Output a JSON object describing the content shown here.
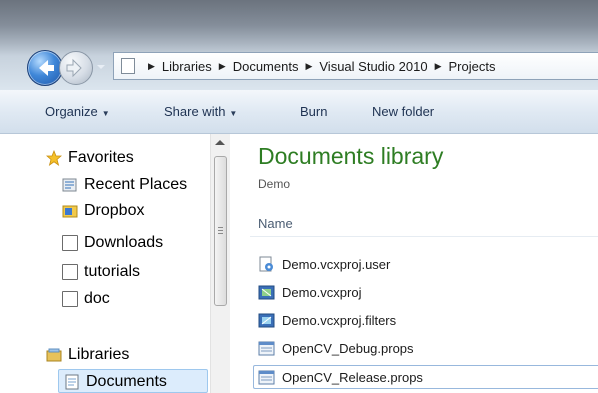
{
  "address": {
    "crumbs": [
      "Libraries",
      "Documents",
      "Visual Studio 2010",
      "Projects"
    ]
  },
  "toolbar": {
    "organize": "Organize",
    "share_with": "Share with",
    "burn": "Burn",
    "new_folder": "New folder"
  },
  "nav": {
    "favorites": "Favorites",
    "items": [
      "Recent Places",
      "Dropbox",
      "Downloads",
      "tutorials",
      "doc"
    ],
    "libraries": "Libraries",
    "documents": "Documents"
  },
  "content": {
    "title": "Documents library",
    "subtitle": "Demo",
    "column_name": "Name",
    "files": [
      "Demo.vcxproj.user",
      "Demo.vcxproj",
      "Demo.vcxproj.filters",
      "OpenCV_Debug.props",
      "OpenCV_Release.props"
    ]
  },
  "colors": {
    "title_green": "#2e7d23",
    "selection_border": "#98b8dd"
  }
}
